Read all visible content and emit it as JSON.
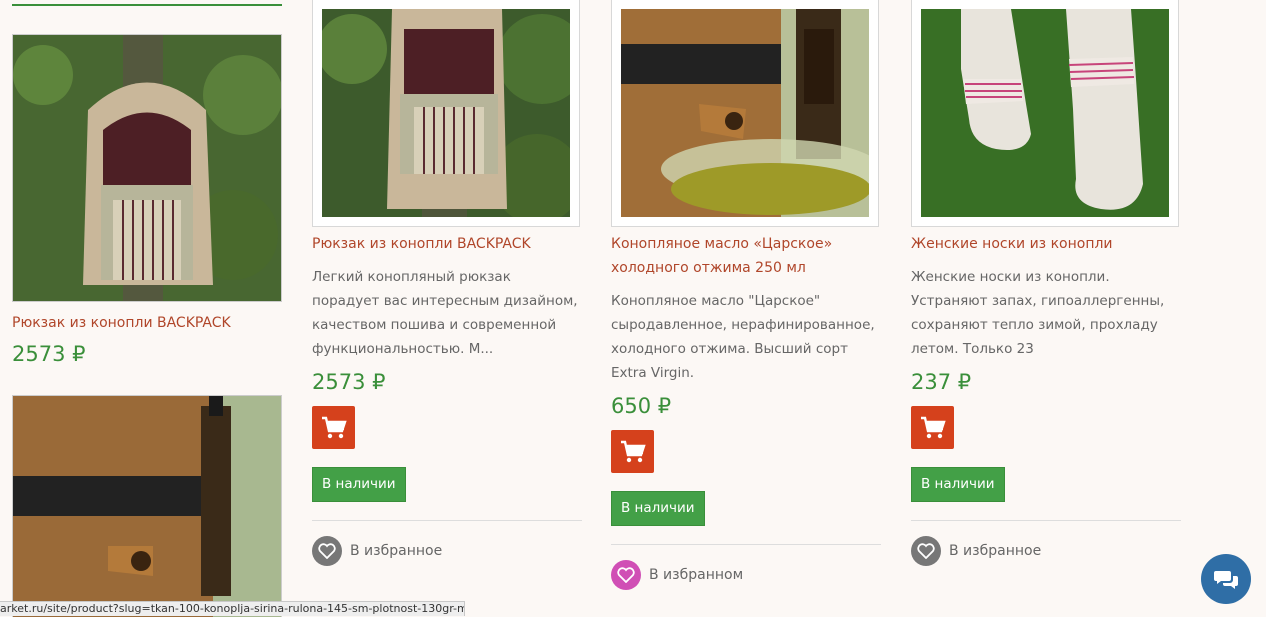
{
  "sidebar": {
    "product1": {
      "title": "Рюкзак из конопли BACKPACK",
      "price": "2573 ₽"
    }
  },
  "products": [
    {
      "title": "Рюкзак из конопли BACKPACK",
      "description": "Легкий конопляный рюкзак порадует вас интересным дизайном, качеством пошива и современной функциональностью. М...",
      "price": "2573 ₽",
      "stock": "В наличии",
      "favorite": "В избранное",
      "favorited": false
    },
    {
      "title": "Конопляное масло «Царское» холодного отжима 250 мл",
      "description": "Конопляное масло \"Царское\" сыродавленное, нерафинированное, холодного отжима. Высший сорт Extra Virgin.",
      "price": "650 ₽",
      "stock": "В наличии",
      "favorite": "В избранном",
      "favorited": true
    },
    {
      "title": "Женские носки из конопли",
      "description": "Женские носки из конопли. Устраняют запах, гипоаллергенны, сохраняют тепло зимой, прохладу летом. Только 23",
      "price": "237 ₽",
      "stock": "В наличии",
      "favorite": "В избранное",
      "favorited": false
    }
  ],
  "status_bar": {
    "url": "arket.ru/site/product?slug=tkan-100-konoplja-sirina-rulona-145-sm-plotnost-130gr-m2"
  },
  "colors": {
    "accent_green": "#3a8f3a",
    "title_red": "#b0462a",
    "cart_orange": "#d5411c",
    "fav_pink": "#d04fb5",
    "chat_blue": "#2f6ea6"
  },
  "icons": {
    "cart": "cart-icon",
    "heart": "heart-icon",
    "chat": "chat-icon"
  }
}
